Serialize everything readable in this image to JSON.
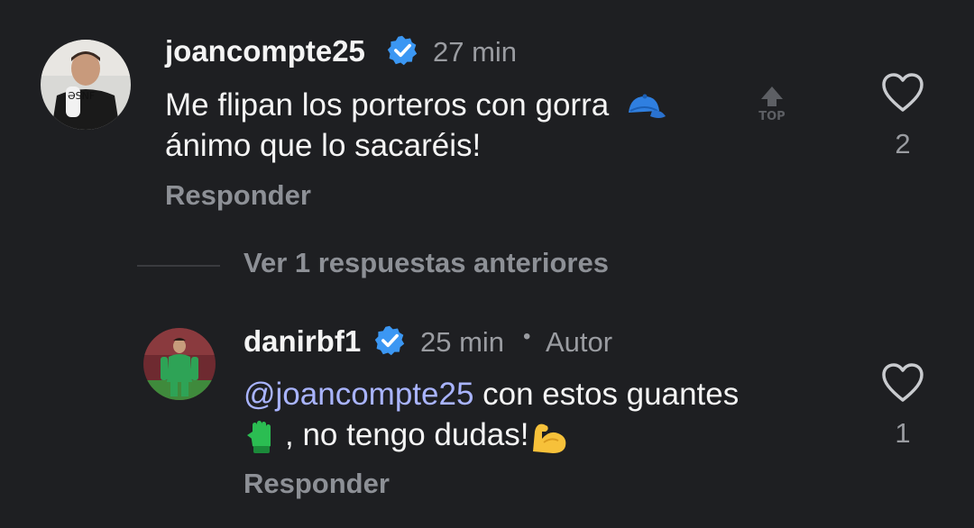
{
  "comment1": {
    "username": "joancompte25",
    "time": "27 min",
    "text_line1": "Me flipan los porteros con gorra",
    "text_line2": "ánimo que lo sacaréis!",
    "reply_label": "Responder",
    "like_count": "2",
    "top_badge": "TOP",
    "icons": [
      "verified-badge-icon",
      "cap-emoji",
      "heart-icon"
    ]
  },
  "thread": {
    "view_replies_label": "Ver 1 respuestas anteriores"
  },
  "comment2": {
    "username": "danirbf1",
    "time": "25 min",
    "separator": "•",
    "author_label": "Autor",
    "mention": "@joancompte25",
    "text_line1_rest": " con estos guantes",
    "text_line2": ", no tengo dudas!",
    "reply_label": "Responder",
    "like_count": "1",
    "icons": [
      "verified-badge-icon",
      "glove-emoji",
      "flexed-biceps-emoji",
      "heart-icon"
    ]
  },
  "colors": {
    "background": "#1e1f22",
    "verified_blue": "#3b97f3",
    "mention": "#a9b4ff",
    "secondary_text": "#9a9ca1"
  }
}
